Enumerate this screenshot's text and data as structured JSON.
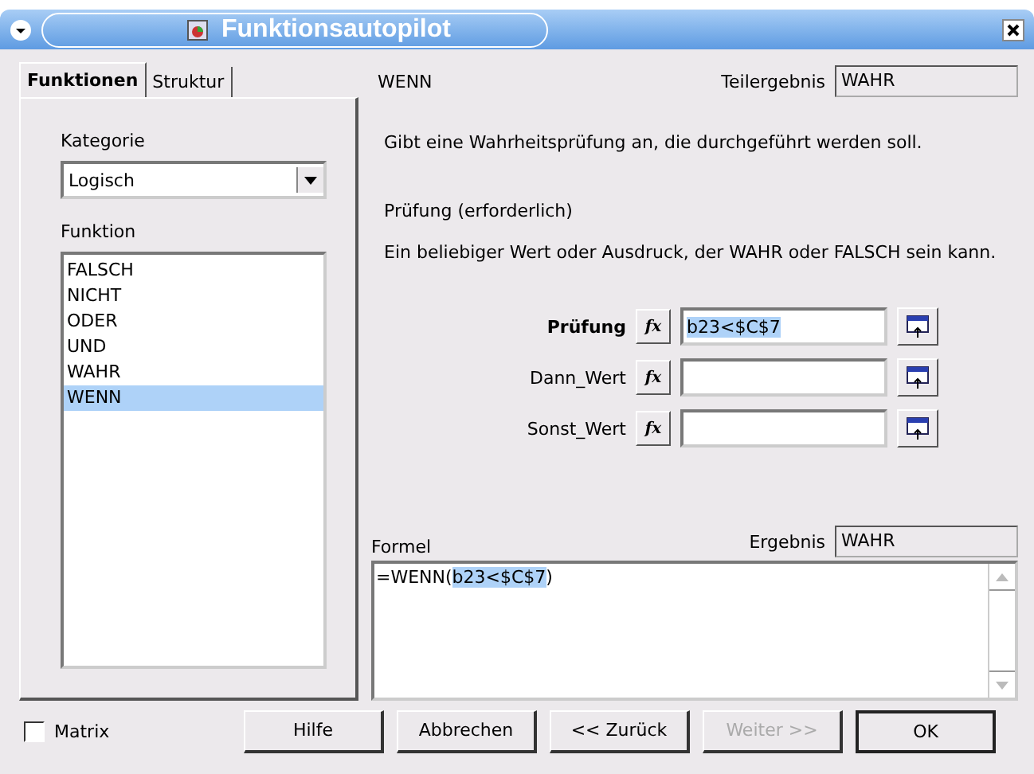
{
  "window": {
    "title": "Funktionsautopilot"
  },
  "tabs": [
    {
      "label": "Funktionen",
      "selected": true
    },
    {
      "label": "Struktur",
      "selected": false
    }
  ],
  "kategorie": {
    "label": "Kategorie",
    "value": "Logisch"
  },
  "funktion": {
    "label": "Funktion",
    "items": [
      {
        "label": "FALSCH",
        "selected": false
      },
      {
        "label": "NICHT",
        "selected": false
      },
      {
        "label": "ODER",
        "selected": false
      },
      {
        "label": "UND",
        "selected": false
      },
      {
        "label": "WAHR",
        "selected": false
      },
      {
        "label": "WENN",
        "selected": true
      }
    ]
  },
  "function_name": "WENN",
  "teilergebnis": {
    "label": "Teilergebnis",
    "value": "WAHR"
  },
  "description": "Gibt eine Wahrheitsprüfung an, die durchgeführt werden soll.",
  "argument_title": "Prüfung (erforderlich)",
  "argument_description": "Ein beliebiger Wert oder Ausdruck, der WAHR oder FALSCH sein kann.",
  "arguments": [
    {
      "label": "Prüfung",
      "fx": "fx",
      "value": "b23<$C$7",
      "selected": true
    },
    {
      "label": "Dann_Wert",
      "fx": "fx",
      "selected": false
    },
    {
      "label": "Sonst_Wert",
      "fx": "fx",
      "selected": false
    }
  ],
  "formel": {
    "label": "Formel",
    "before": "=WENN(",
    "selection": "b23<$C$7",
    "after": ")"
  },
  "ergebnis": {
    "label": "Ergebnis",
    "value": "WAHR"
  },
  "matrix": {
    "label": "Matrix",
    "checked": false
  },
  "buttons": [
    {
      "label": "Hilfe",
      "disabled": false,
      "default": false
    },
    {
      "label": "Abbrechen",
      "disabled": false,
      "default": false
    },
    {
      "label": "<< Zurück",
      "disabled": false,
      "default": false
    },
    {
      "label": "Weiter >>",
      "disabled": true,
      "default": false
    },
    {
      "label": "OK",
      "disabled": false,
      "default": true
    }
  ]
}
